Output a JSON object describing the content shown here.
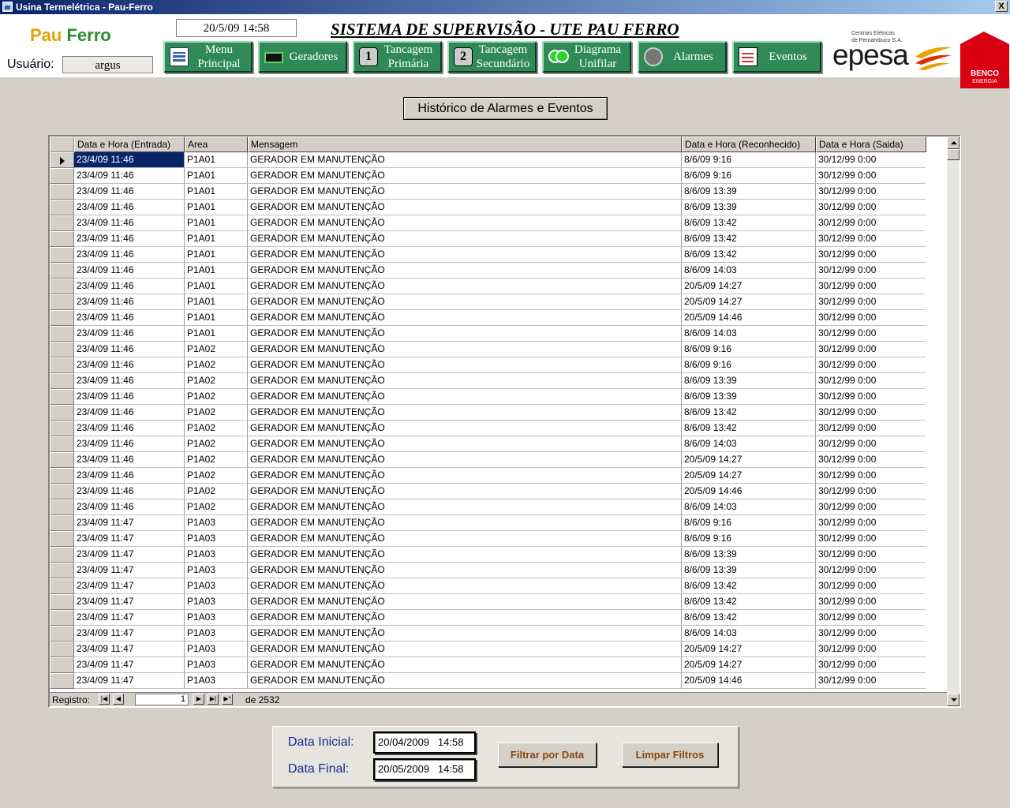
{
  "window": {
    "title": "Usina Termelétrica - Pau-Ferro",
    "close_label": "X"
  },
  "header": {
    "logo_pau": "Pau",
    "logo_ferro": "Ferro",
    "user_label": "Usuário:",
    "user_value": "argus",
    "datetime": "20/5/09 14:58",
    "system_title": "SISTEMA DE SUPERVISÃO - UTE PAU FERRO",
    "epesa_small_1": "Centrais Elétricas",
    "epesa_small_2": "de Pernambuco S.A.",
    "epesa_name": "epesa",
    "benco_name": "BENCO",
    "benco_sub": "ENERGIA"
  },
  "nav": [
    {
      "label_line1": "Menu",
      "label_line2": "Principal",
      "icon": "menu-icon"
    },
    {
      "label_line1": "Geradores",
      "label_line2": "",
      "icon": "generator-icon"
    },
    {
      "label_line1": "Tancagem",
      "label_line2": "Primária",
      "icon": "tank-1-icon",
      "badge": "1"
    },
    {
      "label_line1": "Tancagem",
      "label_line2": "Secundário",
      "icon": "tank-2-icon",
      "badge": "2"
    },
    {
      "label_line1": "Diagrama",
      "label_line2": "Unifilar",
      "icon": "diagram-icon"
    },
    {
      "label_line1": "Alarmes",
      "label_line2": "",
      "icon": "alarm-icon"
    },
    {
      "label_line1": "Eventos",
      "label_line2": "",
      "icon": "events-icon"
    }
  ],
  "history_title": "Histórico de Alarmes e Eventos",
  "grid": {
    "columns": [
      "Data e Hora (Entrada)",
      "Area",
      "Mensagem",
      "Data e Hora (Reconhecido)",
      "Data e Hora (Saida)"
    ],
    "rows": [
      [
        "23/4/09 11:46",
        "P1A01",
        "GERADOR EM MANUTENÇÃO",
        "8/6/09 9:16",
        "30/12/99 0:00"
      ],
      [
        "23/4/09 11:46",
        "P1A01",
        "GERADOR EM MANUTENÇÃO",
        "8/6/09 9:16",
        "30/12/99 0:00"
      ],
      [
        "23/4/09 11:46",
        "P1A01",
        "GERADOR EM MANUTENÇÃO",
        "8/6/09 13:39",
        "30/12/99 0:00"
      ],
      [
        "23/4/09 11:46",
        "P1A01",
        "GERADOR EM MANUTENÇÃO",
        "8/6/09 13:39",
        "30/12/99 0:00"
      ],
      [
        "23/4/09 11:46",
        "P1A01",
        "GERADOR EM MANUTENÇÃO",
        "8/6/09 13:42",
        "30/12/99 0:00"
      ],
      [
        "23/4/09 11:46",
        "P1A01",
        "GERADOR EM MANUTENÇÃO",
        "8/6/09 13:42",
        "30/12/99 0:00"
      ],
      [
        "23/4/09 11:46",
        "P1A01",
        "GERADOR EM MANUTENÇÃO",
        "8/6/09 13:42",
        "30/12/99 0:00"
      ],
      [
        "23/4/09 11:46",
        "P1A01",
        "GERADOR EM MANUTENÇÃO",
        "8/6/09 14:03",
        "30/12/99 0:00"
      ],
      [
        "23/4/09 11:46",
        "P1A01",
        "GERADOR EM MANUTENÇÃO",
        "20/5/09 14:27",
        "30/12/99 0:00"
      ],
      [
        "23/4/09 11:46",
        "P1A01",
        "GERADOR EM MANUTENÇÃO",
        "20/5/09 14:27",
        "30/12/99 0:00"
      ],
      [
        "23/4/09 11:46",
        "P1A01",
        "GERADOR EM MANUTENÇÃO",
        "20/5/09 14:46",
        "30/12/99 0:00"
      ],
      [
        "23/4/09 11:46",
        "P1A01",
        "GERADOR EM MANUTENÇÃO",
        "8/6/09 14:03",
        "30/12/99 0:00"
      ],
      [
        "23/4/09 11:46",
        "P1A02",
        "GERADOR EM MANUTENÇÃO",
        "8/6/09 9:16",
        "30/12/99 0:00"
      ],
      [
        "23/4/09 11:46",
        "P1A02",
        "GERADOR EM MANUTENÇÃO",
        "8/6/09 9:16",
        "30/12/99 0:00"
      ],
      [
        "23/4/09 11:46",
        "P1A02",
        "GERADOR EM MANUTENÇÃO",
        "8/6/09 13:39",
        "30/12/99 0:00"
      ],
      [
        "23/4/09 11:46",
        "P1A02",
        "GERADOR EM MANUTENÇÃO",
        "8/6/09 13:39",
        "30/12/99 0:00"
      ],
      [
        "23/4/09 11:46",
        "P1A02",
        "GERADOR EM MANUTENÇÃO",
        "8/6/09 13:42",
        "30/12/99 0:00"
      ],
      [
        "23/4/09 11:46",
        "P1A02",
        "GERADOR EM MANUTENÇÃO",
        "8/6/09 13:42",
        "30/12/99 0:00"
      ],
      [
        "23/4/09 11:46",
        "P1A02",
        "GERADOR EM MANUTENÇÃO",
        "8/6/09 14:03",
        "30/12/99 0:00"
      ],
      [
        "23/4/09 11:46",
        "P1A02",
        "GERADOR EM MANUTENÇÃO",
        "20/5/09 14:27",
        "30/12/99 0:00"
      ],
      [
        "23/4/09 11:46",
        "P1A02",
        "GERADOR EM MANUTENÇÃO",
        "20/5/09 14:27",
        "30/12/99 0:00"
      ],
      [
        "23/4/09 11:46",
        "P1A02",
        "GERADOR EM MANUTENÇÃO",
        "20/5/09 14:46",
        "30/12/99 0:00"
      ],
      [
        "23/4/09 11:46",
        "P1A02",
        "GERADOR EM MANUTENÇÃO",
        "8/6/09 14:03",
        "30/12/99 0:00"
      ],
      [
        "23/4/09 11:47",
        "P1A03",
        "GERADOR EM MANUTENÇÃO",
        "8/6/09 9:16",
        "30/12/99 0:00"
      ],
      [
        "23/4/09 11:47",
        "P1A03",
        "GERADOR EM MANUTENÇÃO",
        "8/6/09 9:16",
        "30/12/99 0:00"
      ],
      [
        "23/4/09 11:47",
        "P1A03",
        "GERADOR EM MANUTENÇÃO",
        "8/6/09 13:39",
        "30/12/99 0:00"
      ],
      [
        "23/4/09 11:47",
        "P1A03",
        "GERADOR EM MANUTENÇÃO",
        "8/6/09 13:39",
        "30/12/99 0:00"
      ],
      [
        "23/4/09 11:47",
        "P1A03",
        "GERADOR EM MANUTENÇÃO",
        "8/6/09 13:42",
        "30/12/99 0:00"
      ],
      [
        "23/4/09 11:47",
        "P1A03",
        "GERADOR EM MANUTENÇÃO",
        "8/6/09 13:42",
        "30/12/99 0:00"
      ],
      [
        "23/4/09 11:47",
        "P1A03",
        "GERADOR EM MANUTENÇÃO",
        "8/6/09 13:42",
        "30/12/99 0:00"
      ],
      [
        "23/4/09 11:47",
        "P1A03",
        "GERADOR EM MANUTENÇÃO",
        "8/6/09 14:03",
        "30/12/99 0:00"
      ],
      [
        "23/4/09 11:47",
        "P1A03",
        "GERADOR EM MANUTENÇÃO",
        "20/5/09 14:27",
        "30/12/99 0:00"
      ],
      [
        "23/4/09 11:47",
        "P1A03",
        "GERADOR EM MANUTENÇÃO",
        "20/5/09 14:27",
        "30/12/99 0:00"
      ],
      [
        "23/4/09 11:47",
        "P1A03",
        "GERADOR EM MANUTENÇÃO",
        "20/5/09 14:46",
        "30/12/99 0:00"
      ]
    ],
    "selected_row": 0
  },
  "navigator": {
    "label": "Registro:",
    "current": "1",
    "total_text": "de 2532"
  },
  "filter": {
    "start_label": "Data Inicial:",
    "start_value": "20/04/2009   14:58",
    "end_label": "Data Final:",
    "end_value": "20/05/2009   14:58",
    "filter_button": "Filtrar por Data",
    "clear_button": "Limpar Filtros"
  }
}
